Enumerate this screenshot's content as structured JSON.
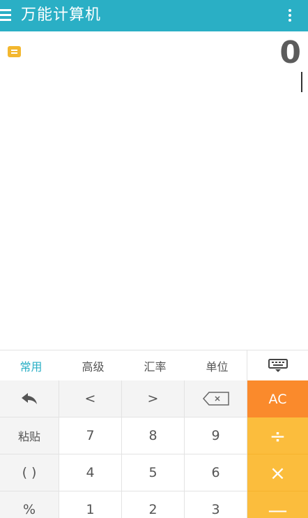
{
  "app_bar": {
    "title": "万能计算机"
  },
  "display": {
    "result": "0"
  },
  "modes": [
    "常用",
    "高级",
    "汇率",
    "单位"
  ],
  "active_mode": "常用",
  "keys": {
    "r0": [
      "",
      "<",
      ">",
      "",
      "AC"
    ],
    "r1": [
      "粘贴",
      "7",
      "8",
      "9",
      "÷"
    ],
    "r2": [
      "( )",
      "4",
      "5",
      "6",
      "×"
    ],
    "r3": [
      "%",
      "1",
      "2",
      "3",
      "—"
    ]
  },
  "icons": {
    "menu": "menu-icon",
    "overflow": "more-vert-icon",
    "history": "history-icon",
    "keyboard": "keyboard-icon",
    "undo": "undo-icon",
    "backspace": "backspace-icon"
  },
  "colors": {
    "app_bar": "#2aafc5",
    "active_tab": "#2aafc5",
    "clear_key": "#fa8a2c",
    "operator_keys": "#fbbd3d",
    "history_icon": "#f3b72f"
  }
}
